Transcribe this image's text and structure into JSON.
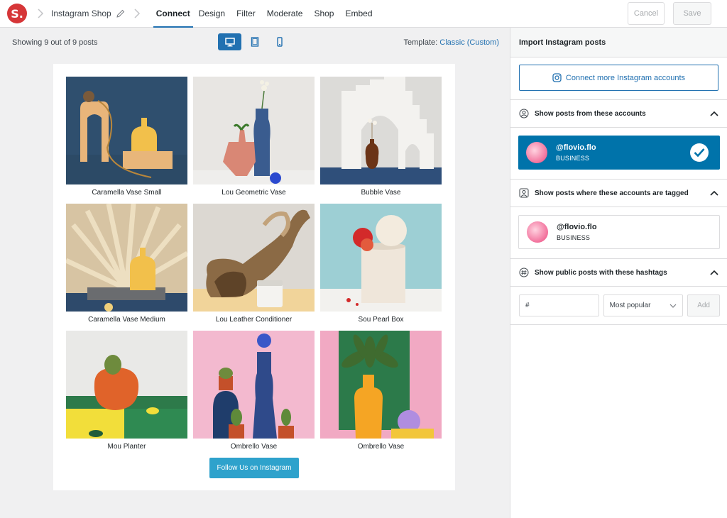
{
  "topbar": {
    "logo_text": "S.",
    "breadcrumb_title": "Instagram Shop",
    "tabs": [
      {
        "label": "Connect",
        "active": true
      },
      {
        "label": "Design"
      },
      {
        "label": "Filter"
      },
      {
        "label": "Moderate"
      },
      {
        "label": "Shop"
      },
      {
        "label": "Embed"
      }
    ],
    "cancel_label": "Cancel",
    "save_label": "Save"
  },
  "toolbar": {
    "showing_text": "Showing 9 out of 9 posts",
    "devices": [
      "desktop-icon",
      "tablet-icon",
      "phone-icon"
    ],
    "template_label": "Template:",
    "template_value": "Classic (Custom)"
  },
  "posts": [
    {
      "caption": "Caramella Vase Small"
    },
    {
      "caption": "Lou Geometric Vase"
    },
    {
      "caption": "Bubble Vase"
    },
    {
      "caption": "Caramella Vase Medium"
    },
    {
      "caption": "Lou Leather Conditioner"
    },
    {
      "caption": "Sou Pearl Box"
    },
    {
      "caption": "Mou Planter"
    },
    {
      "caption": "Ombrello Vase"
    },
    {
      "caption": "Ombrello Vase"
    }
  ],
  "follow_label": "Follow Us on Instagram",
  "sidebar": {
    "title": "Import Instagram posts",
    "connect_label": "Connect more Instagram accounts",
    "sections": {
      "accounts": {
        "label": "Show posts from these accounts"
      },
      "tagged": {
        "label": "Show posts where these accounts are tagged"
      },
      "hashtags": {
        "label": "Show public posts with these hashtags"
      }
    },
    "account_selected": {
      "name": "@flovio.flo",
      "type": "BUSINESS"
    },
    "account_tagged": {
      "name": "@flovio.flo",
      "type": "BUSINESS"
    },
    "hashtag_placeholder": "#",
    "hashtag_sort": "Most popular",
    "add_label": "Add"
  },
  "colors": {
    "accent": "#2271b1",
    "selected_bg": "#0073aa",
    "follow_bg": "#2ea2cc",
    "logo": "#d63638"
  }
}
